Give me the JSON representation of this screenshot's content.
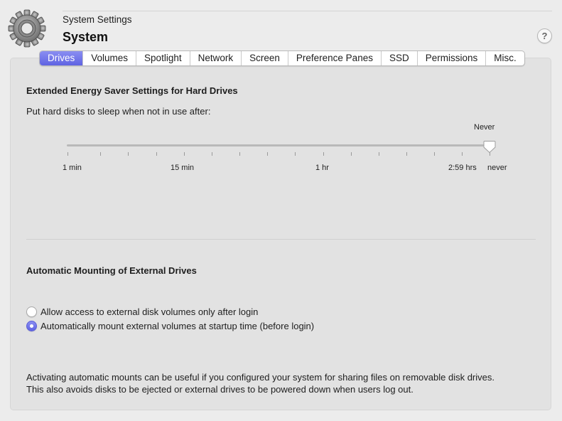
{
  "header": {
    "subtitle": "System Settings",
    "title": "System",
    "help_label": "?"
  },
  "tabs": [
    {
      "label": "Drives",
      "active": true
    },
    {
      "label": "Volumes"
    },
    {
      "label": "Spotlight"
    },
    {
      "label": "Network"
    },
    {
      "label": "Screen"
    },
    {
      "label": "Preference Panes"
    },
    {
      "label": "SSD"
    },
    {
      "label": "Permissions"
    },
    {
      "label": "Misc."
    }
  ],
  "energy": {
    "section_title": "Extended Energy Saver Settings for Hard Drives",
    "prompt": "Put hard disks to sleep when not in use after:",
    "slider": {
      "current_value_label": "Never",
      "tick_labels": [
        "1 min",
        "15 min",
        "1 hr",
        "2:59 hrs",
        "never"
      ],
      "selected": "never"
    }
  },
  "mounting": {
    "section_title": "Automatic Mounting of External Drives",
    "options": [
      {
        "label": "Allow access to external disk volumes only after login",
        "checked": false
      },
      {
        "label": "Automatically mount external volumes at startup time (before login)",
        "checked": true
      }
    ],
    "note_line1": "Activating automatic mounts can be useful if you configured your system for sharing files on removable disk drives.",
    "note_line2": "This also avoids disks to be ejected or external drives to be powered down when users log out."
  },
  "colors": {
    "accent": "#6367e4",
    "panel": "#e2e2e2",
    "window": "#ececec"
  },
  "icons": {
    "app": "gear-icon",
    "help": "help-icon",
    "slider_knob": "slider-knob-icon"
  }
}
